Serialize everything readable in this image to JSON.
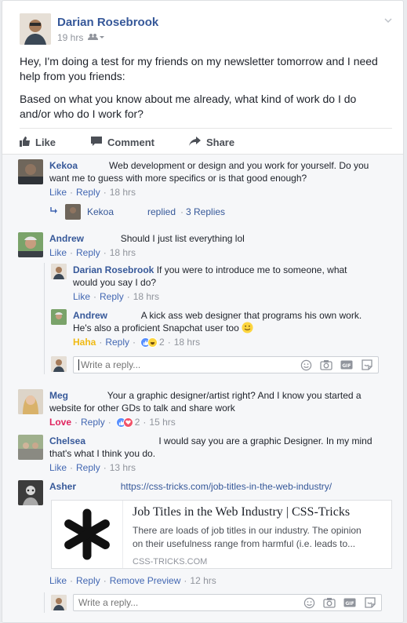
{
  "post": {
    "author": "Darian Rosebrook",
    "time": "19 hrs",
    "body_p1": "Hey, I'm doing a test for my friends on my newsletter tomorrow and I need help from you friends:",
    "body_p2": "Based on what you know about me already, what kind of work do I do and/or who do I work for?"
  },
  "actions": {
    "like": "Like",
    "comment": "Comment",
    "share": "Share"
  },
  "labels": {
    "like": "Like",
    "reply": "Reply",
    "love": "Love",
    "haha": "Haha",
    "replied": "replied",
    "replies": "3 Replies",
    "remove_preview": "Remove Preview",
    "dot": "·"
  },
  "comments": {
    "kekoa": {
      "name": "Kekoa",
      "text": "Web development or design and you work for yourself. Do you want me to guess with more specifics or is that good enough?",
      "time": "18 hrs",
      "reply_name": "Kekoa"
    },
    "andrew": {
      "name": "Andrew",
      "text": "Should I just list everything lol",
      "time": "18 hrs"
    },
    "darian_reply": {
      "name": "Darian Rosebrook",
      "text": "If you were to introduce me to someone, what would you say I do?",
      "time": "18 hrs"
    },
    "andrew_reply": {
      "name": "Andrew",
      "text": "A kick ass web designer that programs his own work. He's also a proficient Snapchat user too",
      "reaction_count": "2",
      "time": "18 hrs"
    },
    "meg": {
      "name": "Meg",
      "text": "Your a graphic designer/artist right? And I know you started a website for other GDs to talk and share work",
      "reaction_count": "2",
      "time": "15 hrs"
    },
    "chelsea": {
      "name": "Chelsea",
      "text": "I would say you are a graphic Designer. In my mind that's what I think you do.",
      "time": "13 hrs"
    },
    "asher": {
      "name": "Asher",
      "link": "https://css-tricks.com/job-titles-in-the-web-industry/",
      "time": "12 hrs"
    }
  },
  "link_preview": {
    "title": "Job Titles in the Web Industry | CSS-Tricks",
    "description": "There are loads of job titles in our industry. The opinion on their usefulness range from harmful (i.e. leads to...",
    "site": "CSS-TRICKS.COM"
  },
  "reply_input": {
    "placeholder": "Write a reply..."
  },
  "colors": {
    "link": "#365899",
    "action": "#4267b2",
    "meta": "#90949c",
    "love": "#e0245e",
    "haha": "#f0ba15"
  }
}
